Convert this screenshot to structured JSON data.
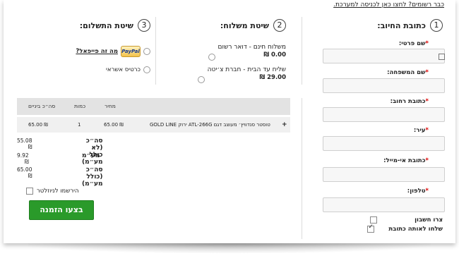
{
  "top_link": "כבר רשומים? לחצו כאן לכניסה למערכת.",
  "billing": {
    "number": "1",
    "title": "כתובת החיוב:",
    "fields": [
      {
        "label": "שם פרטי:"
      },
      {
        "label": "שם המשפחה:"
      },
      {
        "label": "כתובת רחוב:"
      },
      {
        "label": "עיר:"
      },
      {
        "label": "כתובת אי-מייל:"
      },
      {
        "label": "טלפון:"
      }
    ],
    "create_account": "צרו חשבון",
    "ship_same": "שלחו לאותה כתובת"
  },
  "shipping": {
    "number": "2",
    "title": "שיטת משלוח:",
    "options": [
      {
        "label": "משלוח חינם - דואר רשום",
        "price": "0.00 ₪"
      },
      {
        "label": "שליח עד הבית - חברת צ׳יטה",
        "price": "29.00 ₪"
      }
    ]
  },
  "payment": {
    "number": "3",
    "title": "שיטת התשלום:",
    "paypal_link": "מה זה פייפאל?",
    "paypal_badge": "PayPal",
    "credit": "כרטיס אשראי"
  },
  "cart": {
    "headers": {
      "total": "סה״כ ביניים",
      "qty": "כמות",
      "price": "מחיר"
    },
    "rows": [
      {
        "product": "טוסטר סנדוויץ׳ מעוצב דגם ATL-266G ירוק GOLD LINE",
        "price": "65.00 ₪",
        "qty": "1",
        "total": "65.00 ₪",
        "expand": "+"
      }
    ],
    "summary": [
      {
        "label": "סה״כ (לא כולל מע״מ)",
        "value": "55.08 ₪"
      },
      {
        "label": "מע״מ",
        "value": "9.92 ₪"
      },
      {
        "label": "סה״כ (כולל מע״מ)",
        "value": "65.00 ₪"
      }
    ],
    "newsletter": "הירשמו לניוזלטר",
    "order_button": "בצעו הזמנה"
  }
}
